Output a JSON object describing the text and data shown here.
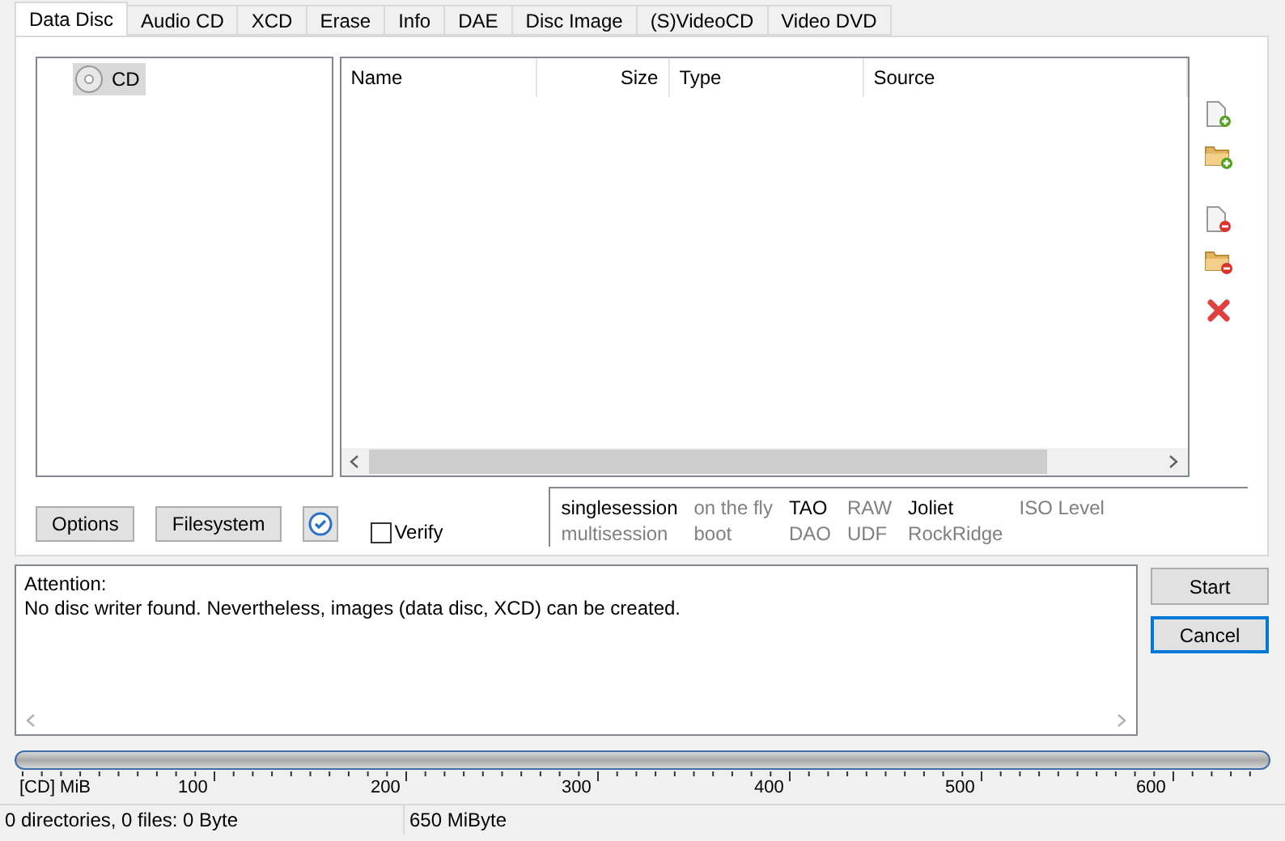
{
  "tabs": [
    {
      "label": "Data Disc",
      "selected": true
    },
    {
      "label": "Audio CD",
      "selected": false
    },
    {
      "label": "XCD",
      "selected": false
    },
    {
      "label": "Erase",
      "selected": false
    },
    {
      "label": "Info",
      "selected": false
    },
    {
      "label": "DAE",
      "selected": false
    },
    {
      "label": "Disc Image",
      "selected": false
    },
    {
      "label": "(S)VideoCD",
      "selected": false
    },
    {
      "label": "Video DVD",
      "selected": false
    }
  ],
  "tree": {
    "items": [
      {
        "label": "CD",
        "selected": true
      }
    ]
  },
  "file_list": {
    "columns": [
      "Name",
      "Size",
      "Type",
      "Source"
    ]
  },
  "side_tools": [
    {
      "kind": "add-file"
    },
    {
      "kind": "add-folder"
    },
    {
      "kind": "remove-file"
    },
    {
      "kind": "remove-folder"
    },
    {
      "kind": "clear"
    }
  ],
  "buttons": [
    {
      "label": "Options"
    },
    {
      "label": "Filesystem"
    }
  ],
  "verify": {
    "label": "Verify",
    "checked": false
  },
  "session_options": [
    [
      {
        "label": "singlesession",
        "active": true
      },
      {
        "label": "multisession",
        "active": false
      }
    ],
    [
      {
        "label": "on the fly",
        "active": false
      },
      {
        "label": "boot",
        "active": false
      }
    ],
    [
      {
        "label": "TAO",
        "active": true
      },
      {
        "label": "DAO",
        "active": false
      }
    ],
    [
      {
        "label": "RAW",
        "active": false
      },
      {
        "label": "UDF",
        "active": false
      }
    ],
    [
      {
        "label": "Joliet",
        "active": true
      },
      {
        "label": "RockRidge",
        "active": false
      }
    ],
    [
      {
        "label": "ISO Level",
        "active": false
      }
    ]
  ],
  "messages": [
    "Attention:",
    "No disc writer found. Nevertheless, images (data disc, XCD) can be created."
  ],
  "actions": [
    {
      "label": "Start",
      "focused": false
    },
    {
      "label": "Cancel",
      "focused": true
    }
  ],
  "capacity": {
    "unit": "[CD] MiB",
    "ticks": [
      "100",
      "200",
      "300",
      "400",
      "500",
      "600"
    ]
  },
  "status_bar": [
    "0 directories, 0 files: 0 Byte",
    "650 MiByte"
  ]
}
